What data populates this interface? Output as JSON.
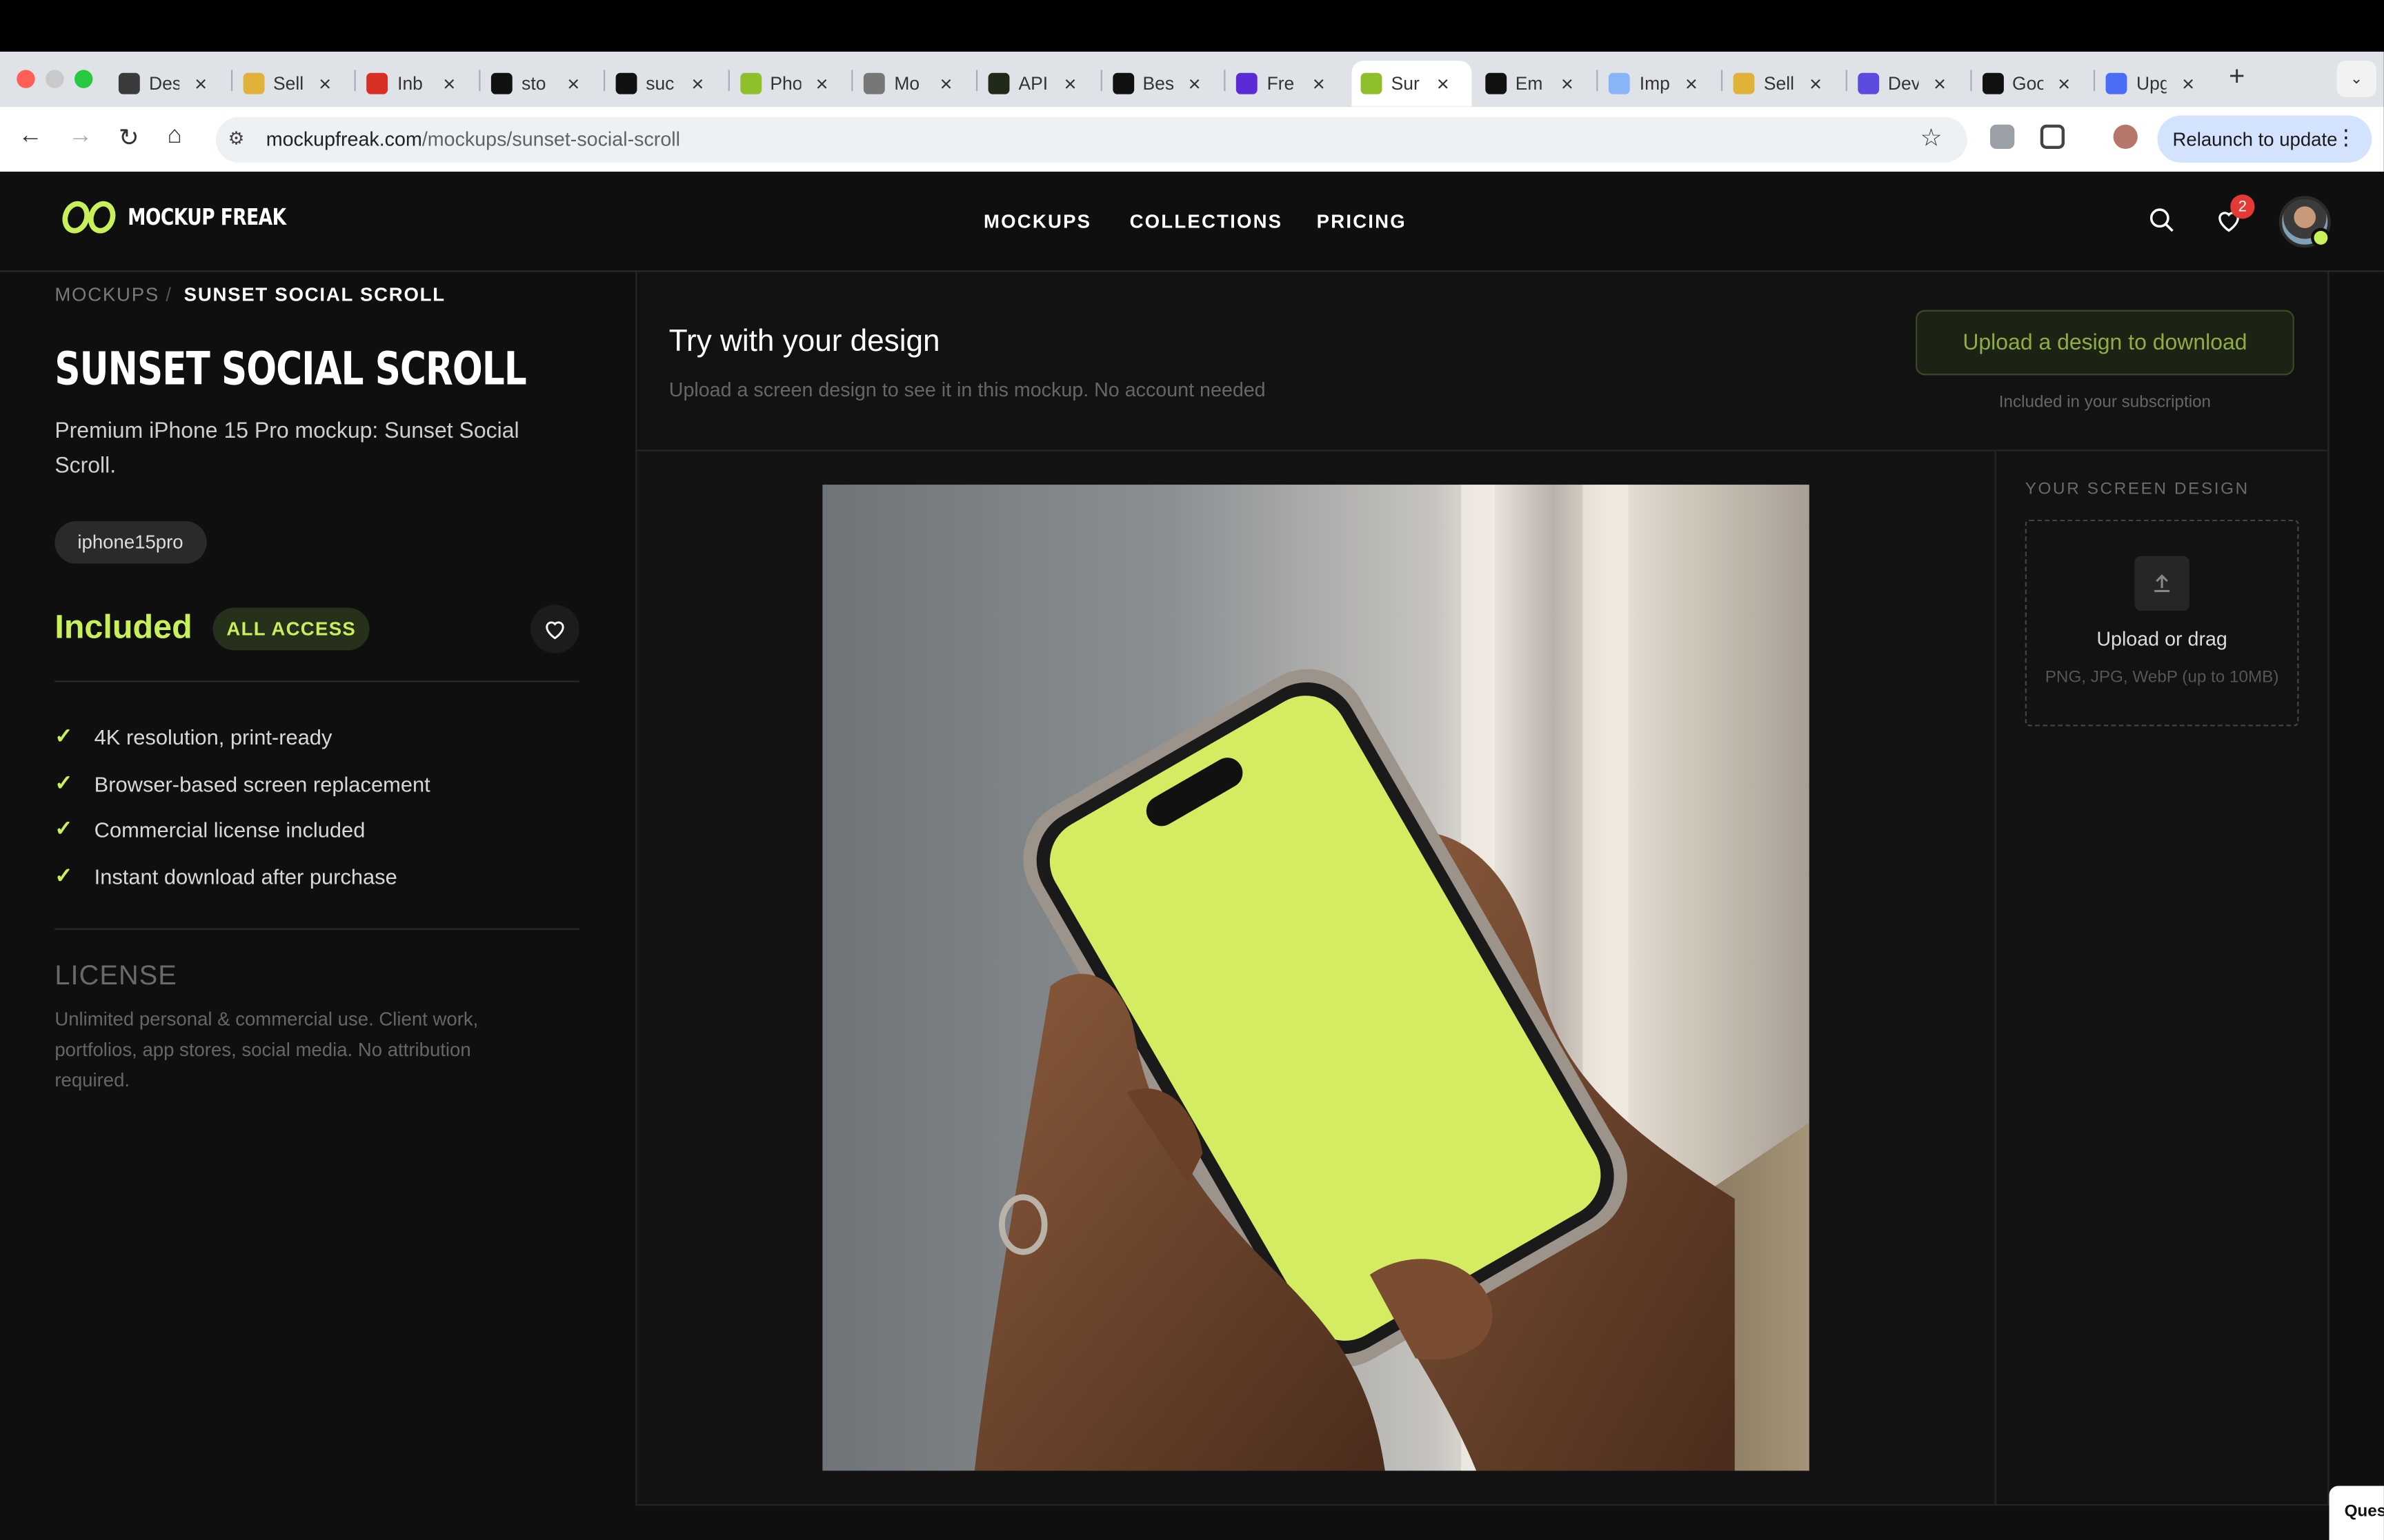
{
  "browser": {
    "tabs": [
      {
        "title": "Des",
        "fav": "#3b3b3b",
        "icon": "openai-icon"
      },
      {
        "title": "Sell",
        "fav": "#e0b23a",
        "icon": "pen-icon"
      },
      {
        "title": "Inb",
        "fav": "#d93025",
        "icon": "gmail-icon"
      },
      {
        "title": "sto",
        "fav": "#111111",
        "icon": "triangle-icon"
      },
      {
        "title": "suc",
        "fav": "#111111",
        "icon": "github-icon"
      },
      {
        "title": "Pho",
        "fav": "#8fbf2a",
        "icon": "eyes-icon"
      },
      {
        "title": "Mo",
        "fav": "#777777",
        "icon": "globe-icon"
      },
      {
        "title": "API",
        "fav": "#1f2a1a",
        "icon": "bolt-icon"
      },
      {
        "title": "Bes",
        "fav": "#111111",
        "icon": "mm-icon"
      },
      {
        "title": "Fre",
        "fav": "#5b2bd6",
        "icon": "circle-icon"
      },
      {
        "title": "Sur",
        "fav": "#8fbf2a",
        "icon": "eyes-icon"
      },
      {
        "title": "Em",
        "fav": "#111111",
        "icon": "r-icon"
      },
      {
        "title": "Imp",
        "fav": "#8ab4f8",
        "icon": "globe-icon"
      },
      {
        "title": "Sell",
        "fav": "#e0b23a",
        "icon": "pen-icon"
      },
      {
        "title": "Dev",
        "fav": "#5b4bdf",
        "icon": "square-icon"
      },
      {
        "title": "Goo",
        "fav": "#111111",
        "icon": "plus-icon"
      },
      {
        "title": "Upg",
        "fav": "#4a6cf7",
        "icon": "doc-icon"
      }
    ],
    "active_tab_index": 10,
    "url_host": "mockupfreak.com",
    "url_path": "/mockups/sunset-social-scroll",
    "relaunch_label": "Relaunch to update"
  },
  "header": {
    "logo_text": "MOCKUP FREAK",
    "nav": [
      "MOCKUPS",
      "COLLECTIONS",
      "PRICING"
    ],
    "wishlist_count": "2",
    "accent_color": "#c8f05a"
  },
  "left": {
    "breadcrumb": [
      "MOCKUPS",
      "/",
      "SUNSET SOCIAL SCROLL"
    ],
    "title": "SUNSET SOCIAL SCROLL",
    "description": "Premium iPhone 15 Pro mockup: Sunset Social Scroll.",
    "tag": "iphone15pro",
    "price_label": "Included",
    "access_badge": "ALL ACCESS",
    "features": [
      "4K resolution, print-ready",
      "Browser-based screen replacement",
      "Commercial license included",
      "Instant download after purchase"
    ],
    "license_heading": "LICENSE",
    "license_text": "Unlimited personal & commercial use. Client work, portfolios, app stores, social media. No attribution required."
  },
  "main": {
    "heading": "Try with your design",
    "subheading": "Upload a screen design to see it in this mockup. No account needed",
    "download_button": "Upload a design to download",
    "download_sub": "Included in your subscription",
    "screen_design_label": "YOUR SCREEN DESIGN",
    "dropzone_title": "Upload or drag",
    "dropzone_sub": "PNG, JPG, WebP (up to 10MB)",
    "screen_color": "#d4ec62"
  },
  "help_widget": "Ques"
}
